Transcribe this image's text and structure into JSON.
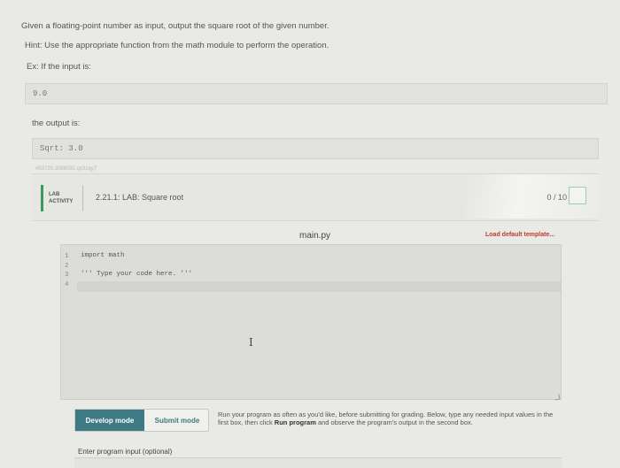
{
  "description": {
    "line1": "Given a floating-point number as input, output the square root of the given number.",
    "line2": "Hint: Use the appropriate function from the math module to perform the operation.",
    "line3": "Ex: If the input is:"
  },
  "example_input": "9.0",
  "output_label": "the output is:",
  "example_output": "Sqrt: 3.0",
  "faded_id": "453720.3086092.qx3zqy7",
  "lab": {
    "badge_line1": "LAB",
    "badge_line2": "ACTIVITY",
    "title": "2.21.1: LAB: Square root",
    "score": "0 / 10"
  },
  "editor": {
    "file_name": "main.py",
    "load_default": "Load default template...",
    "line_numbers": [
      "1",
      "2",
      "3",
      "4"
    ],
    "lines": [
      "import math",
      "",
      "''' Type your code here. '''",
      ""
    ]
  },
  "modes": {
    "develop": "Develop mode",
    "submit": "Submit mode"
  },
  "run_description": {
    "part1": "Run your program as often as you'd like, before submitting for grading. Below, type any needed input values in the first box, then click ",
    "bold": "Run program",
    "part2": " and observe the program's output in the second box."
  },
  "input_label": "Enter program input (optional)"
}
